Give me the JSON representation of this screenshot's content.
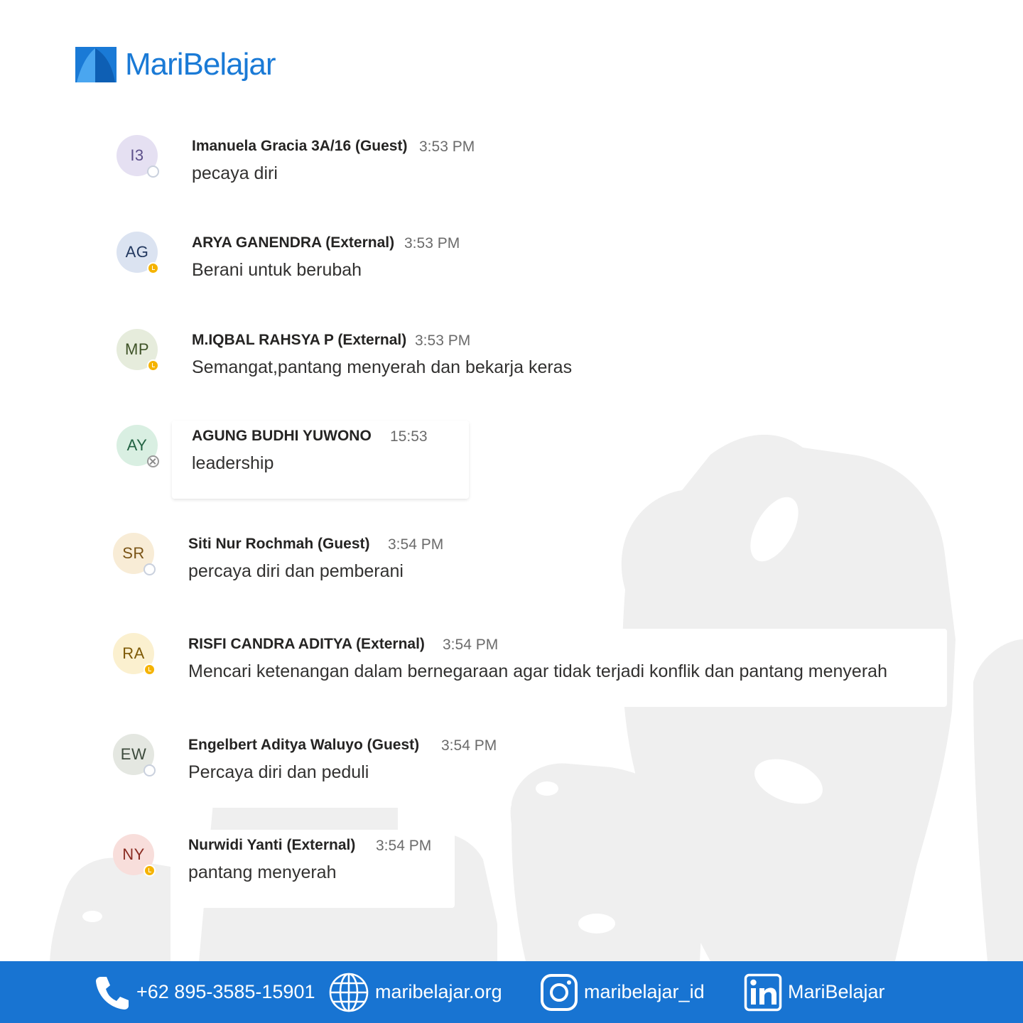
{
  "brand": {
    "name": "MariBelajar",
    "logo_icon": "maribelajar-logo-icon",
    "color": "#1a7ad6"
  },
  "chat": {
    "messages": [
      {
        "initials": "I3",
        "name": "Imanuela Gracia 3A/16 (Guest)",
        "time": "3:53 PM",
        "text": "pecaya diri",
        "status": "offline",
        "avatar_bg": "#e5e0f2",
        "avatar_fg": "#5c4f8a"
      },
      {
        "initials": "AG",
        "name": "ARYA GANENDRA (External)",
        "time": "3:53 PM",
        "text": "Berani untuk berubah",
        "status": "away",
        "avatar_bg": "#dbe3f1",
        "avatar_fg": "#22385f"
      },
      {
        "initials": "MP",
        "name": "M.IQBAL RAHSYA P (External)",
        "time": "3:53 PM",
        "text": "Semangat,pantang menyerah dan bekarja keras",
        "status": "away",
        "avatar_bg": "#e6ecdc",
        "avatar_fg": "#3e5227"
      },
      {
        "initials": "AY",
        "name": "AGUNG BUDHI YUWONO",
        "time": "15:53",
        "text": "leadership",
        "status": "dnd",
        "avatar_bg": "#d9efe2",
        "avatar_fg": "#236343"
      },
      {
        "initials": "SR",
        "name": "Siti Nur Rochmah (Guest)",
        "time": "3:54 PM",
        "text": "percaya diri dan pemberani",
        "status": "offline",
        "avatar_bg": "#f8ecd6",
        "avatar_fg": "#7a5416"
      },
      {
        "initials": "RA",
        "name": "RISFI CANDRA ADITYA (External)",
        "time": "3:54 PM",
        "text": "Mencari ketenangan dalam bernegaraan agar tidak terjadi konflik dan pantang menyerah",
        "status": "away",
        "avatar_bg": "#fbf0cf",
        "avatar_fg": "#7e5a06"
      },
      {
        "initials": "EW",
        "name": "Engelbert Aditya Waluyo (Guest)",
        "time": "3:54 PM",
        "text": "Percaya diri dan peduli",
        "status": "offline",
        "avatar_bg": "#e4e7e1",
        "avatar_fg": "#3c4a3c"
      },
      {
        "initials": "NY",
        "name": "Nurwidi Yanti (External)",
        "time": "3:54 PM",
        "text": "pantang menyerah",
        "status": "away",
        "avatar_bg": "#f8dedb",
        "avatar_fg": "#8a2c22"
      }
    ]
  },
  "footer": {
    "background": "#1874d2",
    "phone": {
      "icon": "phone-icon",
      "label": "+62 895-3585-15901"
    },
    "website": {
      "icon": "globe-icon",
      "label": "maribelajar.org"
    },
    "instagram": {
      "icon": "instagram-icon",
      "label": "maribelajar_id"
    },
    "linkedin": {
      "icon": "linkedin-icon",
      "label": "MariBelajar"
    }
  }
}
